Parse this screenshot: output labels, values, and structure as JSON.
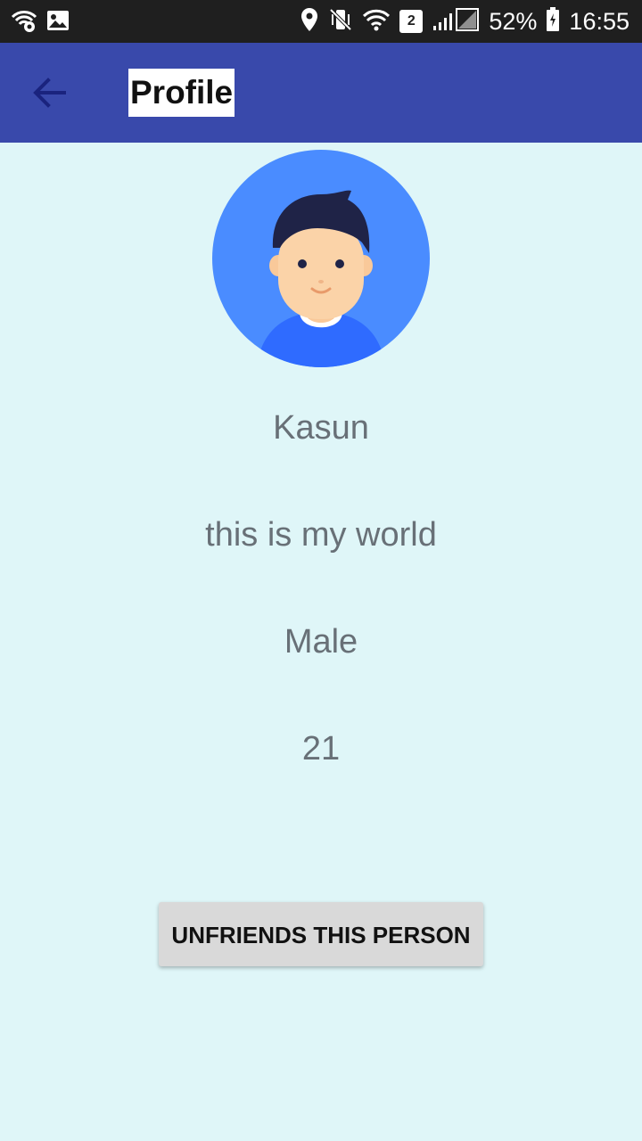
{
  "status_bar": {
    "battery": "52%",
    "time": "16:55",
    "sim_badge": "2"
  },
  "toolbar": {
    "title": "Profile",
    "back_icon": "arrow-back-icon"
  },
  "profile": {
    "avatar_icon": "user-avatar-icon",
    "name": "Kasun",
    "status": "this is my world",
    "gender": "Male",
    "age": "21"
  },
  "actions": {
    "unfriend_label": "UNFRIENDS THIS PERSON"
  },
  "colors": {
    "toolbar": "#3949ab",
    "background": "#dff6f8",
    "avatar_circle": "#4a8cff",
    "text": "#687077",
    "button": "#d9d9d9"
  }
}
